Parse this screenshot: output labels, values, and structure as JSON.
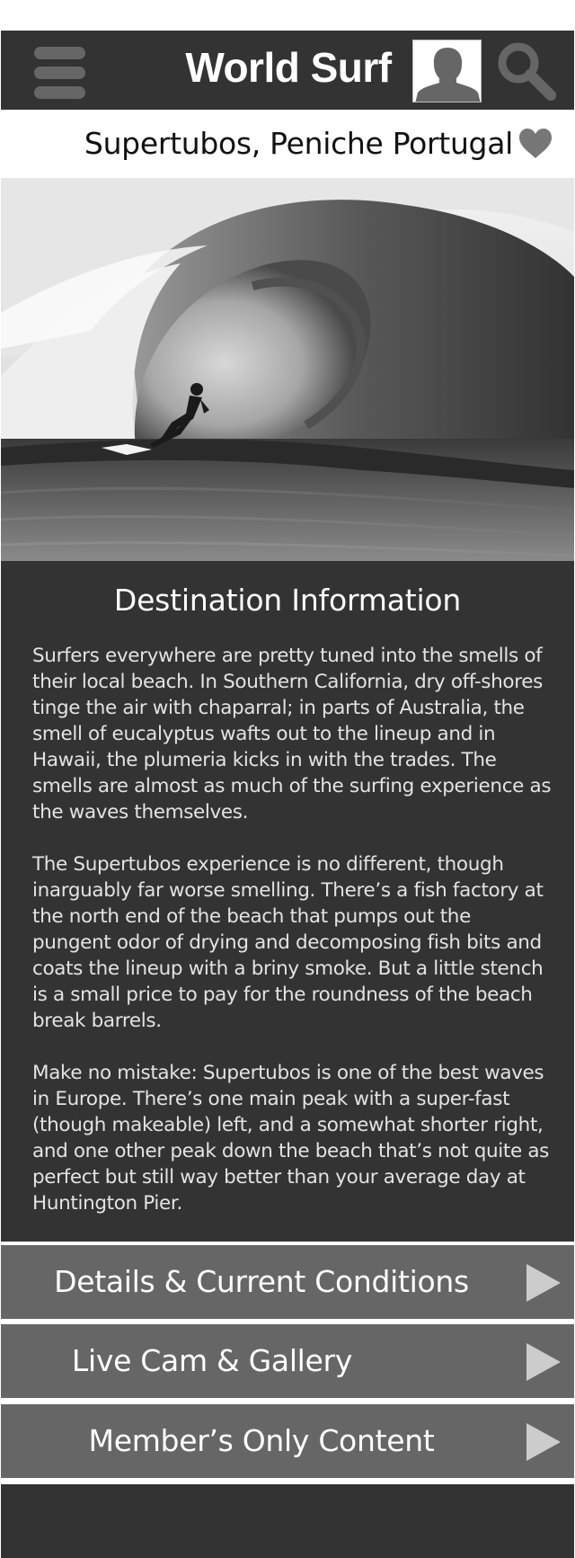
{
  "header": {
    "title": "World Surf",
    "menu_icon": "hamburger-menu-icon",
    "avatar_icon": "user-avatar-icon",
    "search_icon": "search-icon"
  },
  "location": {
    "name": "Supertubos, Peniche Portugal",
    "favorite_icon": "heart-icon"
  },
  "hero": {
    "image": "surfer-in-barrel-wave-photo"
  },
  "info": {
    "title": "Destination Information",
    "paragraphs": [
      "Surfers everywhere are pretty tuned into the smells of their local beach. In Southern California, dry off-shores tinge the air with chaparral; in parts of Australia, the smell of eucalyptus wafts out to the lineup and in Hawaii, the plumeria kicks in with the trades. The smells are almost as much of the surfing experience as the waves themselves.",
      "The Supertubos experience is no different, though inarguably far worse smelling. There’s a fish factory at the north end of the beach that pumps out the pungent odor of drying and decomposing fish bits and coats the lineup with a briny smoke. But a little stench is a small price to pay for the roundness of the beach break barrels.",
      "Make no mistake: Supertubos is one of the best waves in Europe. There’s one main peak with a super-fast (though makeable) left, and a somewhat shorter right, and one other peak down the beach that’s not quite as perfect but still way better than your average day at Huntington Pier."
    ]
  },
  "nav": [
    {
      "label": "Details & Current Conditions",
      "icon": "play-arrow-icon"
    },
    {
      "label": "Live Cam & Gallery",
      "icon": "play-arrow-icon"
    },
    {
      "label": "Member’s Only Content",
      "icon": "play-arrow-icon"
    }
  ],
  "colors": {
    "header_bg": "#333333",
    "panel_bg": "#333333",
    "button_bg": "#666666",
    "icon_gray": "#666666",
    "text_light": "#ffffff"
  }
}
